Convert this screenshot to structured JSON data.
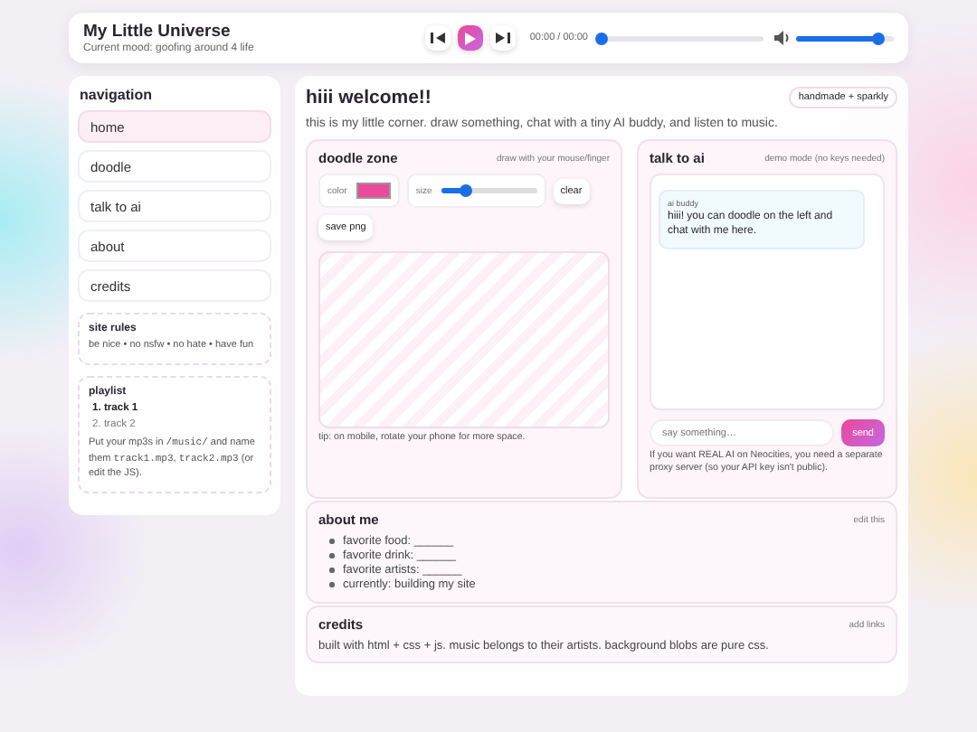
{
  "player": {
    "title": "My Little Universe",
    "subtitle": "Current mood: goofing around 4 life",
    "playing": false,
    "time": "00:00 / 00:00",
    "progress": {
      "level": 0
    },
    "volume": {
      "level": 0.85
    }
  },
  "sidebar": {
    "heading": "navigation",
    "items": [
      {
        "label": "home",
        "selected": true
      },
      {
        "label": "doodle",
        "selected": false
      },
      {
        "label": "talk to ai",
        "selected": false
      },
      {
        "label": "about",
        "selected": false
      },
      {
        "label": "credits",
        "selected": false
      }
    ],
    "site_rules": {
      "title": "site rules",
      "text": "be nice • no nsfw • no hate • have fun"
    },
    "playlist": {
      "title": "playlist",
      "tracks": [
        {
          "number": "1.",
          "label": "track 1",
          "selected": true
        },
        {
          "number": "2.",
          "label": "track 2",
          "selected": false
        }
      ],
      "note": [
        {
          "kind": "text",
          "text": "Put your mp3s in "
        },
        {
          "kind": "code",
          "text": "/music/"
        },
        {
          "kind": "text",
          "text": " and name them "
        },
        {
          "kind": "code",
          "text": "track1.mp3"
        },
        {
          "kind": "text",
          "text": ", "
        },
        {
          "kind": "code",
          "text": "track2.mp3"
        },
        {
          "kind": "text",
          "text": " (or edit the JS)."
        }
      ]
    }
  },
  "main": {
    "title": "hiii welcome!!",
    "badge": "handmade + sparkly",
    "intro": "this is my little corner. draw something, chat with a tiny AI buddy, and listen to music.",
    "doodle": {
      "title": "doodle zone",
      "hint": "draw with your mouse/finger",
      "color_label": "color",
      "color": "#ec4a9c",
      "size_label": "size",
      "size": {
        "level": 0.25
      },
      "clear": "clear",
      "save": "save png",
      "tip": "tip: on mobile, rotate your phone for more space."
    },
    "chat": {
      "title": "talk to ai",
      "hint": "demo mode (no keys needed)",
      "messages": [
        {
          "sender": "ai buddy",
          "text": "hiii! you can doodle on the left and chat with me here."
        }
      ],
      "input": {
        "placeholder": "say something…"
      },
      "send": "send",
      "note": "If you want REAL AI on Neocities, you need a separate proxy server (so your API key isn't public)."
    },
    "about": {
      "title": "about me",
      "action": "edit this",
      "items": [
        "favorite food: ______",
        "favorite drink: ______",
        "favorite artists: ______",
        "currently: building my site"
      ]
    },
    "credits": {
      "title": "credits",
      "action": "add links",
      "text": "built with html + css + js. music belongs to their artists. background blobs are pure css."
    }
  }
}
